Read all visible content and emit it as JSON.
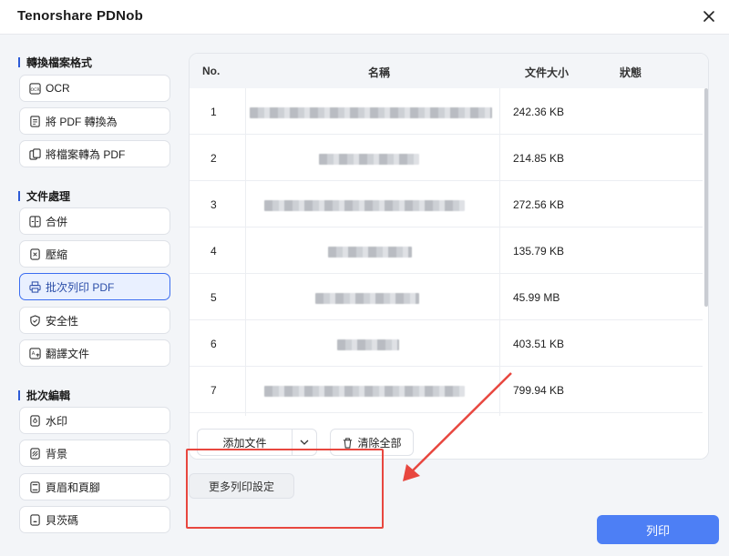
{
  "window": {
    "title": "Tenorshare PDNob"
  },
  "sidebar": {
    "sections": [
      {
        "title": "轉換檔案格式",
        "items": [
          {
            "label": "OCR",
            "icon": "ocr-icon"
          },
          {
            "label": "將 PDF 轉換為",
            "icon": "pdf-convert-icon"
          },
          {
            "label": "將檔案轉為 PDF",
            "icon": "file-to-pdf-icon"
          }
        ]
      },
      {
        "title": "文件處理",
        "items": [
          {
            "label": "合併",
            "icon": "merge-icon"
          },
          {
            "label": "壓縮",
            "icon": "compress-icon"
          },
          {
            "label": "批次列印 PDF",
            "icon": "printer-icon",
            "active": true
          },
          {
            "label": "安全性",
            "icon": "shield-icon"
          },
          {
            "label": "翻譯文件",
            "icon": "translate-icon"
          }
        ]
      },
      {
        "title": "批次編輯",
        "items": [
          {
            "label": "水印",
            "icon": "watermark-icon"
          },
          {
            "label": "背景",
            "icon": "background-icon"
          },
          {
            "label": "頁眉和頁腳",
            "icon": "header-footer-icon"
          },
          {
            "label": "貝茨碼",
            "icon": "bates-icon"
          }
        ]
      }
    ]
  },
  "table": {
    "columns": [
      "No.",
      "名稱",
      "文件大小",
      "狀態"
    ],
    "rows": [
      {
        "no": "1",
        "size": "242.36 KB"
      },
      {
        "no": "2",
        "size": "214.85 KB"
      },
      {
        "no": "3",
        "size": "272.56 KB"
      },
      {
        "no": "4",
        "size": "135.79 KB"
      },
      {
        "no": "5",
        "size": "45.99 MB"
      },
      {
        "no": "6",
        "size": "403.51 KB"
      },
      {
        "no": "7",
        "size": "799.94 KB"
      }
    ]
  },
  "toolbar": {
    "add_label": "添加文件",
    "clear_label": "清除全部",
    "more_settings_label": "更多列印設定"
  },
  "footer": {
    "print_label": "列印"
  },
  "colors": {
    "accent": "#4d7ff5",
    "annotation": "#e8473f"
  }
}
